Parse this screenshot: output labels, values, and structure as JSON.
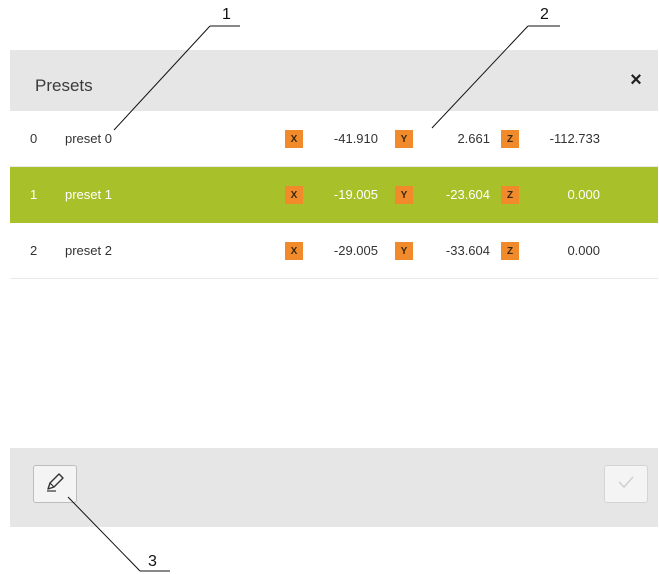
{
  "dialog": {
    "title": "Presets",
    "close_label": "×"
  },
  "presets": [
    {
      "index": "0",
      "name": "preset 0",
      "x": "-41.910",
      "y": "2.661",
      "z": "-112.733",
      "selected": false
    },
    {
      "index": "1",
      "name": "preset 1",
      "x": "-19.005",
      "y": "-23.604",
      "z": "0.000",
      "selected": true
    },
    {
      "index": "2",
      "name": "preset 2",
      "x": "-29.005",
      "y": "-33.604",
      "z": "0.000",
      "selected": false
    }
  ],
  "axes": {
    "x": "X",
    "y": "Y",
    "z": "Z"
  },
  "footer": {
    "edit_icon": "pencil-icon",
    "confirm_icon": "checkmark-icon"
  },
  "callouts": [
    "1",
    "2",
    "3"
  ],
  "colors": {
    "selected_row": "#a8c02a",
    "axis_badge": "#f08a2a",
    "header_bg": "#e6e6e6"
  }
}
